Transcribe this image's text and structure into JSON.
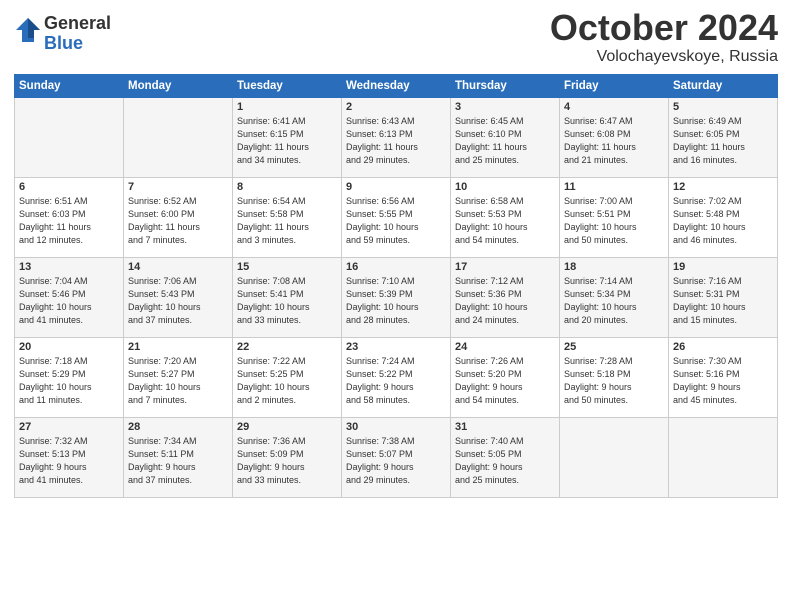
{
  "logo": {
    "general": "General",
    "blue": "Blue"
  },
  "title": "October 2024",
  "location": "Volochayevskoye, Russia",
  "days_of_week": [
    "Sunday",
    "Monday",
    "Tuesday",
    "Wednesday",
    "Thursday",
    "Friday",
    "Saturday"
  ],
  "weeks": [
    [
      {
        "num": "",
        "info": ""
      },
      {
        "num": "",
        "info": ""
      },
      {
        "num": "1",
        "info": "Sunrise: 6:41 AM\nSunset: 6:15 PM\nDaylight: 11 hours\nand 34 minutes."
      },
      {
        "num": "2",
        "info": "Sunrise: 6:43 AM\nSunset: 6:13 PM\nDaylight: 11 hours\nand 29 minutes."
      },
      {
        "num": "3",
        "info": "Sunrise: 6:45 AM\nSunset: 6:10 PM\nDaylight: 11 hours\nand 25 minutes."
      },
      {
        "num": "4",
        "info": "Sunrise: 6:47 AM\nSunset: 6:08 PM\nDaylight: 11 hours\nand 21 minutes."
      },
      {
        "num": "5",
        "info": "Sunrise: 6:49 AM\nSunset: 6:05 PM\nDaylight: 11 hours\nand 16 minutes."
      }
    ],
    [
      {
        "num": "6",
        "info": "Sunrise: 6:51 AM\nSunset: 6:03 PM\nDaylight: 11 hours\nand 12 minutes."
      },
      {
        "num": "7",
        "info": "Sunrise: 6:52 AM\nSunset: 6:00 PM\nDaylight: 11 hours\nand 7 minutes."
      },
      {
        "num": "8",
        "info": "Sunrise: 6:54 AM\nSunset: 5:58 PM\nDaylight: 11 hours\nand 3 minutes."
      },
      {
        "num": "9",
        "info": "Sunrise: 6:56 AM\nSunset: 5:55 PM\nDaylight: 10 hours\nand 59 minutes."
      },
      {
        "num": "10",
        "info": "Sunrise: 6:58 AM\nSunset: 5:53 PM\nDaylight: 10 hours\nand 54 minutes."
      },
      {
        "num": "11",
        "info": "Sunrise: 7:00 AM\nSunset: 5:51 PM\nDaylight: 10 hours\nand 50 minutes."
      },
      {
        "num": "12",
        "info": "Sunrise: 7:02 AM\nSunset: 5:48 PM\nDaylight: 10 hours\nand 46 minutes."
      }
    ],
    [
      {
        "num": "13",
        "info": "Sunrise: 7:04 AM\nSunset: 5:46 PM\nDaylight: 10 hours\nand 41 minutes."
      },
      {
        "num": "14",
        "info": "Sunrise: 7:06 AM\nSunset: 5:43 PM\nDaylight: 10 hours\nand 37 minutes."
      },
      {
        "num": "15",
        "info": "Sunrise: 7:08 AM\nSunset: 5:41 PM\nDaylight: 10 hours\nand 33 minutes."
      },
      {
        "num": "16",
        "info": "Sunrise: 7:10 AM\nSunset: 5:39 PM\nDaylight: 10 hours\nand 28 minutes."
      },
      {
        "num": "17",
        "info": "Sunrise: 7:12 AM\nSunset: 5:36 PM\nDaylight: 10 hours\nand 24 minutes."
      },
      {
        "num": "18",
        "info": "Sunrise: 7:14 AM\nSunset: 5:34 PM\nDaylight: 10 hours\nand 20 minutes."
      },
      {
        "num": "19",
        "info": "Sunrise: 7:16 AM\nSunset: 5:31 PM\nDaylight: 10 hours\nand 15 minutes."
      }
    ],
    [
      {
        "num": "20",
        "info": "Sunrise: 7:18 AM\nSunset: 5:29 PM\nDaylight: 10 hours\nand 11 minutes."
      },
      {
        "num": "21",
        "info": "Sunrise: 7:20 AM\nSunset: 5:27 PM\nDaylight: 10 hours\nand 7 minutes."
      },
      {
        "num": "22",
        "info": "Sunrise: 7:22 AM\nSunset: 5:25 PM\nDaylight: 10 hours\nand 2 minutes."
      },
      {
        "num": "23",
        "info": "Sunrise: 7:24 AM\nSunset: 5:22 PM\nDaylight: 9 hours\nand 58 minutes."
      },
      {
        "num": "24",
        "info": "Sunrise: 7:26 AM\nSunset: 5:20 PM\nDaylight: 9 hours\nand 54 minutes."
      },
      {
        "num": "25",
        "info": "Sunrise: 7:28 AM\nSunset: 5:18 PM\nDaylight: 9 hours\nand 50 minutes."
      },
      {
        "num": "26",
        "info": "Sunrise: 7:30 AM\nSunset: 5:16 PM\nDaylight: 9 hours\nand 45 minutes."
      }
    ],
    [
      {
        "num": "27",
        "info": "Sunrise: 7:32 AM\nSunset: 5:13 PM\nDaylight: 9 hours\nand 41 minutes."
      },
      {
        "num": "28",
        "info": "Sunrise: 7:34 AM\nSunset: 5:11 PM\nDaylight: 9 hours\nand 37 minutes."
      },
      {
        "num": "29",
        "info": "Sunrise: 7:36 AM\nSunset: 5:09 PM\nDaylight: 9 hours\nand 33 minutes."
      },
      {
        "num": "30",
        "info": "Sunrise: 7:38 AM\nSunset: 5:07 PM\nDaylight: 9 hours\nand 29 minutes."
      },
      {
        "num": "31",
        "info": "Sunrise: 7:40 AM\nSunset: 5:05 PM\nDaylight: 9 hours\nand 25 minutes."
      },
      {
        "num": "",
        "info": ""
      },
      {
        "num": "",
        "info": ""
      }
    ]
  ]
}
